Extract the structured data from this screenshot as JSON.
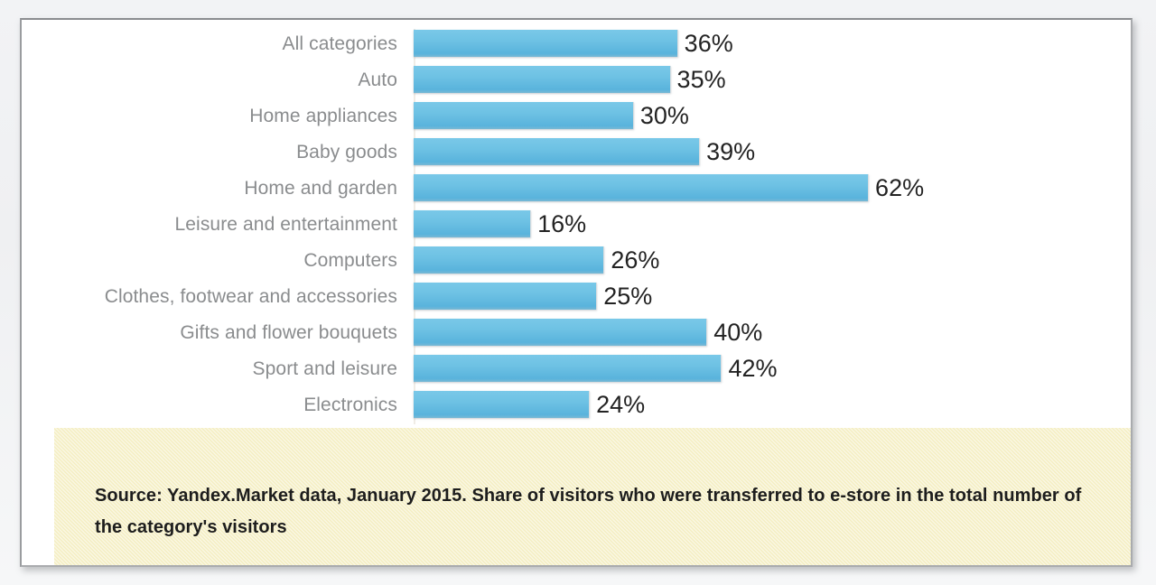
{
  "chart_data": {
    "type": "bar",
    "orientation": "horizontal",
    "title": "",
    "xlabel": "",
    "ylabel": "",
    "xlim": [
      0,
      62
    ],
    "grid": false,
    "legend": null,
    "value_suffix": "%",
    "categories": [
      "All categories",
      "Auto",
      "Home appliances",
      "Baby goods",
      "Home and garden",
      "Leisure and entertainment",
      "Computers",
      "Clothes, footwear and accessories",
      "Gifts and flower bouquets",
      "Sport and leisure",
      "Electronics"
    ],
    "values": [
      36,
      35,
      30,
      39,
      62,
      16,
      26,
      25,
      40,
      42,
      24
    ],
    "value_labels": [
      "36%",
      "35%",
      "30%",
      "39%",
      "62%",
      "16%",
      "26%",
      "25%",
      "40%",
      "42%",
      "24%"
    ],
    "bar_color": "#6ec2e4",
    "label_color": "#8a8c8e",
    "value_color": "#232323"
  },
  "source": {
    "text": "Source: Yandex.Market data, January 2015. Share of visitors who were transferred to e-store in the total number of the category's visitors",
    "background_color": "#f4eec2"
  }
}
